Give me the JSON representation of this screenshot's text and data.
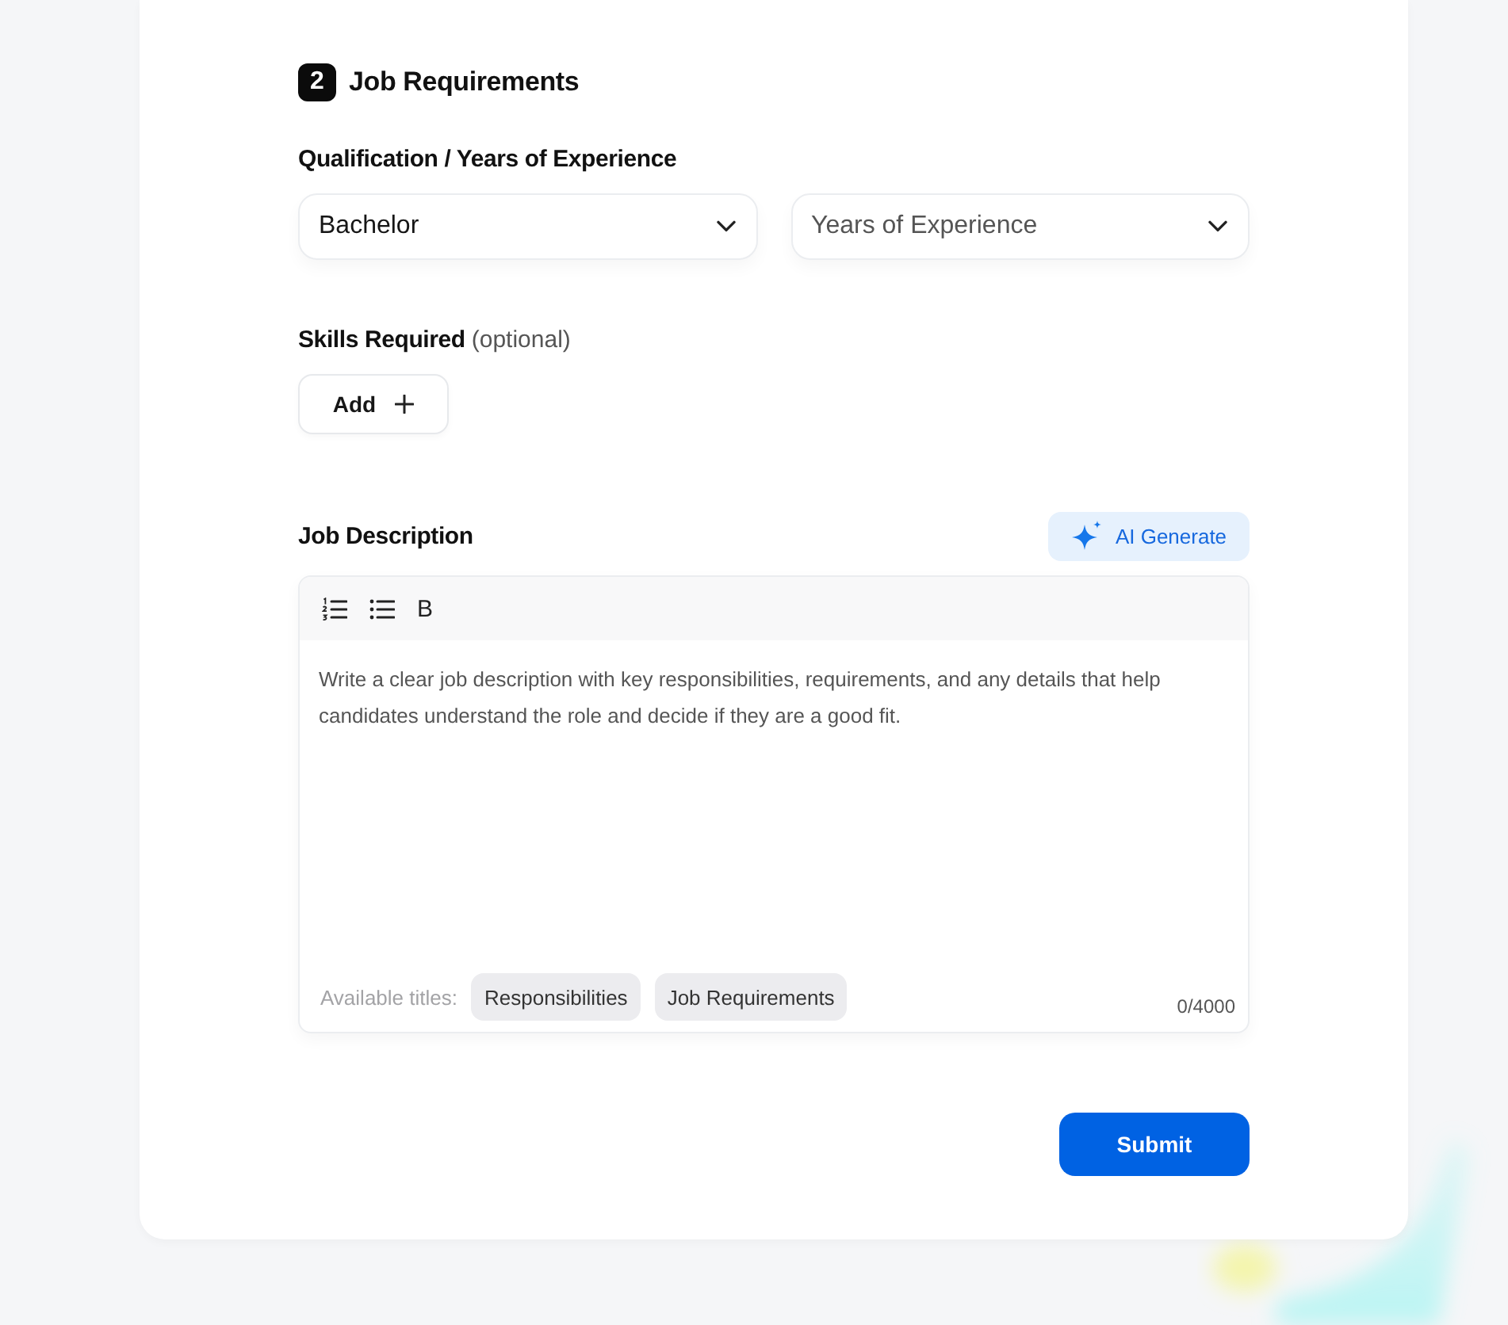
{
  "section": {
    "step": "2",
    "title": "Job Requirements"
  },
  "qualification": {
    "label": "Qualification / Years of Experience",
    "qualification_select": {
      "value": "Bachelor"
    },
    "experience_select": {
      "placeholder": "Years of Experience"
    }
  },
  "skills": {
    "label": "Skills Required",
    "note": "(optional)",
    "add_button": "Add"
  },
  "job_description": {
    "label": "Job Description",
    "ai_button": "AI Generate",
    "toolbar": [
      {
        "kind": "numbered-list"
      },
      {
        "kind": "bullet-list"
      },
      {
        "kind": "bold",
        "label": "B"
      }
    ],
    "placeholder": "Write a clear job description with key responsibilities, requirements, and any details that help candidates understand the role and decide if they are a good fit.",
    "titles_label": "Available titles:",
    "titles": [
      "Responsibilities",
      "Job Requirements"
    ],
    "counter": "0/4000"
  },
  "submit_button": "Submit"
}
